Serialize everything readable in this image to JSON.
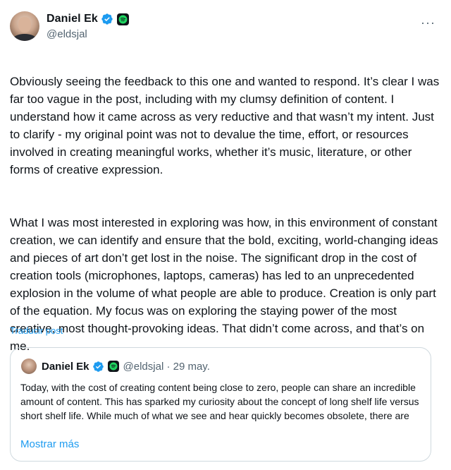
{
  "tweet": {
    "author_name": "Daniel Ek",
    "handle": "@eldsjal",
    "more_icon": "more-horizontal-icon",
    "paragraphs": [
      "Obviously seeing the feedback to this one and wanted to respond. It’s clear I was far too vague in the post, including with my clumsy definition of content. I understand how it came across as very reductive and that wasn’t my intent. Just to clarify - my original point was not to devalue the time, effort, or resources involved in creating meaningful works, whether it’s music, literature, or other forms of creative expression.",
      "What I was most interested in exploring was how, in this environment of constant creation, we can identify and ensure that the bold, exciting, world-changing ideas and pieces of art don’t get lost in the noise. The significant drop in the cost of creation tools (microphones, laptops, cameras) has led to an unprecedented explosion in the volume of what people are able to produce. Creation is only part of the equation. My focus was on exploring the staying power of the most creative, most thought-provoking ideas. That didn’t come across, and that’s on me."
    ],
    "translate_label": "Traducir post"
  },
  "quoted": {
    "author_name": "Daniel Ek",
    "handle_date": "@eldsjal · 29 may.",
    "text": "Today, with the cost of creating content being close to zero, people can share an incredible amount of content. This has sparked my curiosity about the concept of long shelf life versus short shelf life. While much of what we see and hear quickly becomes obsolete, there are",
    "show_more_label": "Mostrar más"
  },
  "colors": {
    "verified": "#1d9bf0",
    "link": "#1d9bf0",
    "spotify_green": "#1ed760",
    "text": "#0f1419",
    "secondary": "#536471"
  }
}
